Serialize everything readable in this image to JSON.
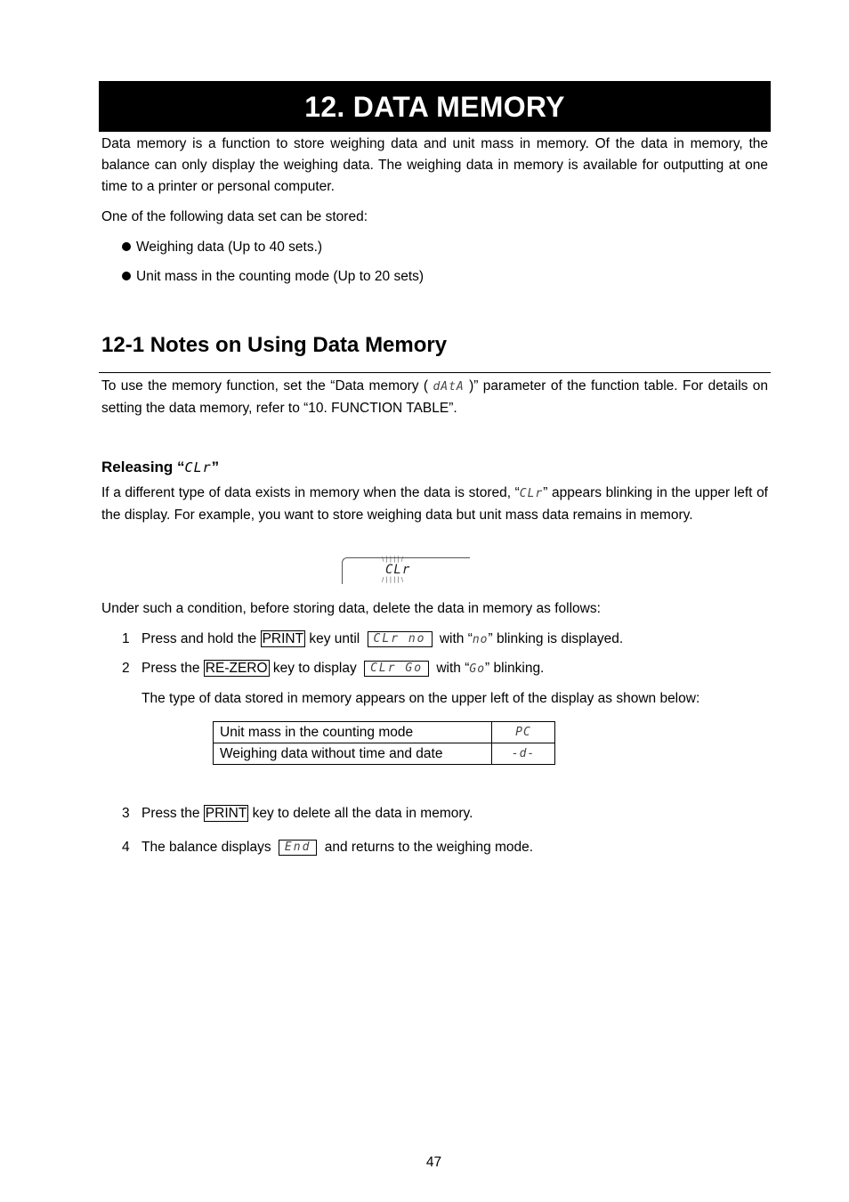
{
  "title": "12.  DATA MEMORY",
  "intro": {
    "paragraph": "Data memory is a function to store weighing data and unit mass in memory. Of the data in memory, the balance can only display the weighing data. The weighing data in memory is available for outputting at one time to a printer or personal computer.",
    "list_lead": "One of the following data set can be stored:",
    "bullets": [
      "Weighing data (Up to 40 sets.)",
      "Unit mass in the counting mode (Up to 20 sets)"
    ]
  },
  "section": {
    "heading": "12-1  Notes on Using Data Memory",
    "para_before": "To use the memory function, set the “Data memory ( ",
    "para_code": "dAtA",
    "para_after": " )” parameter of the function table. For details on setting the data memory, refer to “10. FUNCTION TABLE”."
  },
  "releasing": {
    "heading_prefix": "Releasing “",
    "heading_code": "CLr",
    "heading_suffix": "”",
    "para_before": "If a different type of data exists in memory when the data is stored, “",
    "para_code": "CLr",
    "para_after": "” appears blinking in the upper left of the display. For example, you want to store weighing data but unit mass data remains in memory.",
    "display_text": "CLr",
    "lead": "Under such a condition, before storing data, delete the data in memory as follows:"
  },
  "steps": [
    {
      "num": "1",
      "pre": "Press and hold the ",
      "key": "PRINT",
      "mid": " key until ",
      "lcd": "CLr no",
      "post_a": " with “",
      "code": "no",
      "post_b": "” blinking is displayed."
    },
    {
      "num": "2",
      "pre": "Press the ",
      "key": "RE-ZERO",
      "mid": " key to display ",
      "lcd": "CLr Go",
      "post_a": " with “",
      "code": "Go",
      "post_b": "” blinking."
    },
    {
      "num": "3",
      "pre": "Press the ",
      "key": "PRINT",
      "mid": " key to delete all the data in memory."
    },
    {
      "num": "4",
      "pre": "The balance displays ",
      "lcd": "End",
      "mid": " and returns to the weighing mode."
    }
  ],
  "type_note": "The type of data stored in memory appears on the upper left of the display as shown below:",
  "type_table": [
    {
      "description": "Unit mass in the counting mode",
      "code": "PC"
    },
    {
      "description": "Weighing data without time and date",
      "code": "-d-"
    }
  ],
  "page_number": "47"
}
